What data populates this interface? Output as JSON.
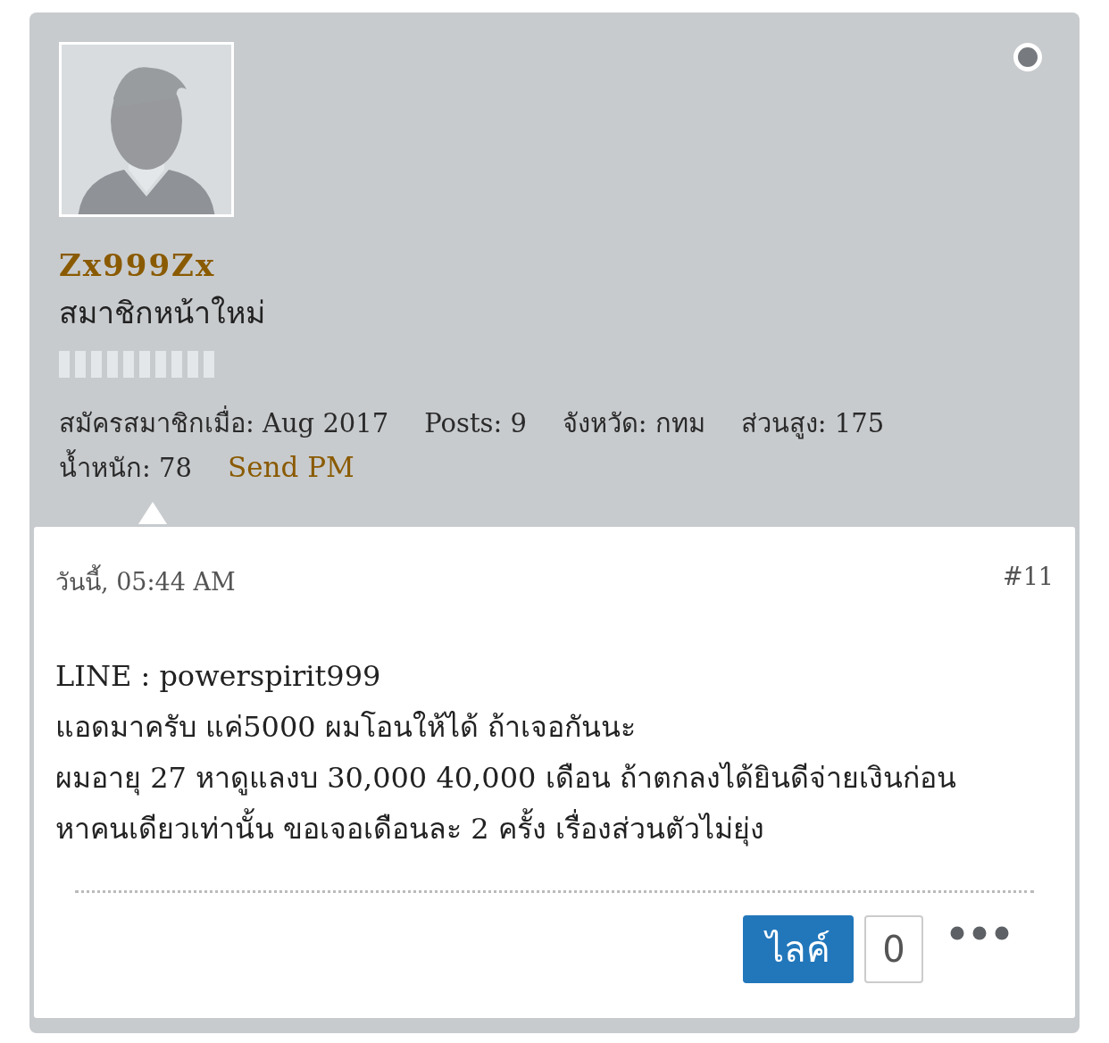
{
  "user": {
    "name": "Zx999Zx",
    "rank": "สมาชิกหน้าใหม่",
    "online": false,
    "info": [
      {
        "label": "สมัครสมาชิกเมื่อ:",
        "value": "Aug 2017"
      },
      {
        "label": "Posts:",
        "value": "9"
      },
      {
        "label": "จังหวัด:",
        "value": "กทม"
      },
      {
        "label": "ส่วนสูง:",
        "value": "175"
      },
      {
        "label": "น้ำหนัก:",
        "value": "78"
      }
    ],
    "send_pm": "Send PM"
  },
  "post": {
    "date": "วันนี้, 05:44 AM",
    "number": "#11",
    "lines": [
      "LINE : powerspirit999",
      "แอดมาครับ แค่5000 ผมโอนให้ได้ ถ้าเจอกันนะ",
      "ผมอายุ 27 หาดูแลงบ 30,000 40,000 เดือน ถ้าตกลงได้ยินดีจ่ายเงินก่อน",
      "หาคนเดียวเท่านั้น ขอเจอเดือนละ 2 ครั้ง เรื่องส่วนตัวไม่ยุ่ง"
    ],
    "like_label": "ไลค์",
    "like_count": "0"
  }
}
